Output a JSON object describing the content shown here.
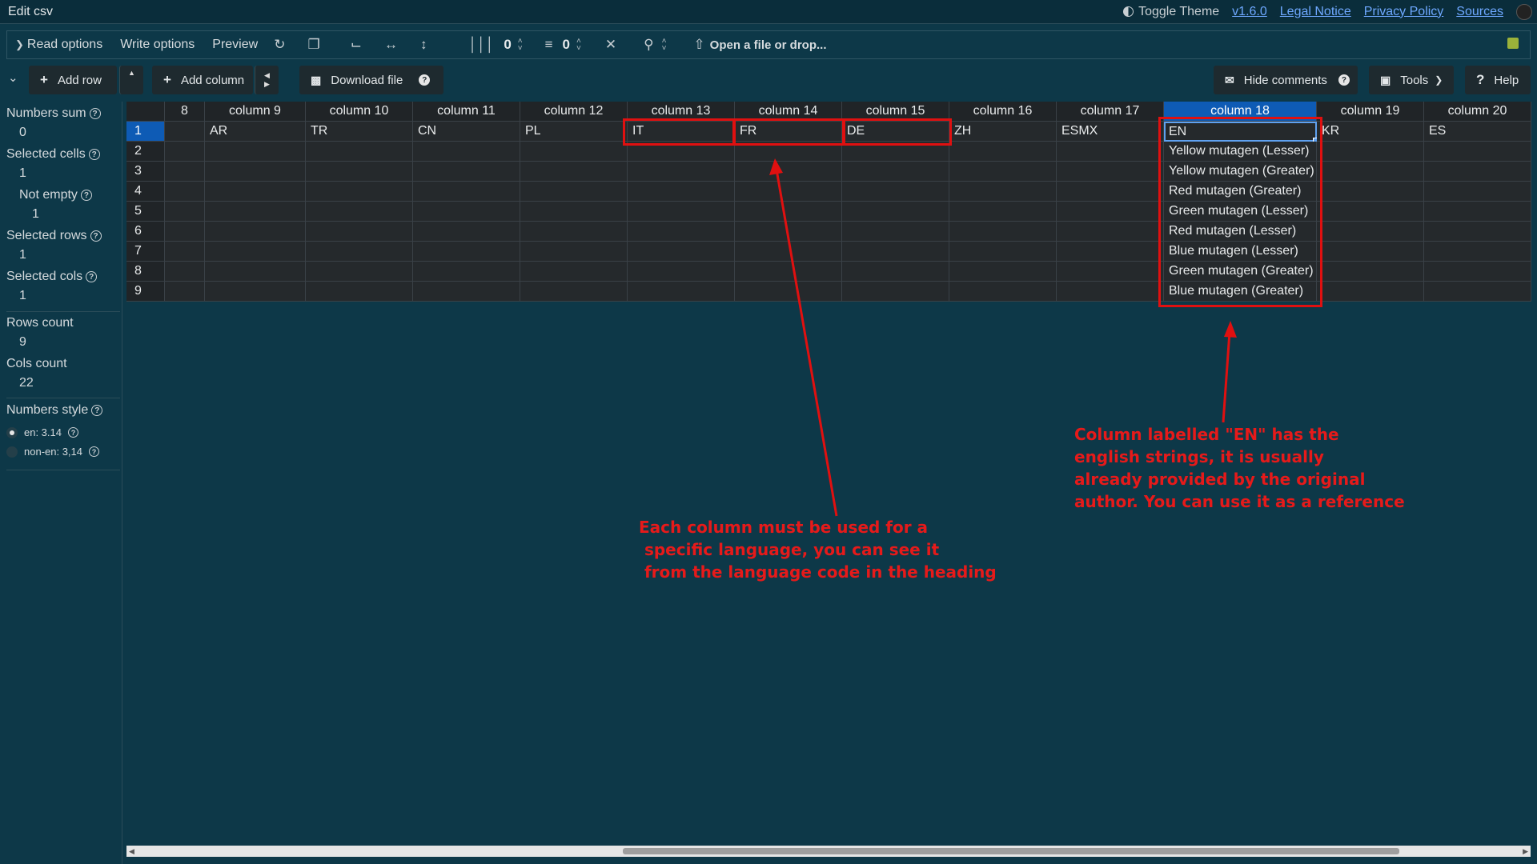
{
  "window": {
    "title": "Edit csv",
    "theme_toggle": "Toggle Theme",
    "links": [
      "v1.6.0",
      "Legal Notice",
      "Privacy Policy",
      "Sources"
    ]
  },
  "toolbar": {
    "read_options": "Read options",
    "write_options": "Write options",
    "preview": "Preview",
    "fixed_cols_value": "0",
    "fixed_rows_value": "0",
    "open_file": "Open a file or drop...",
    "icons": [
      "reload-icon",
      "copy-icon",
      "resize-icon",
      "expand-horizontal-icon",
      "expand-vertical-icon",
      "fixed-columns-icon",
      "fixed-rows-icon",
      "close-wrap-icon",
      "zoom-icon",
      "upload-icon",
      "save-icon"
    ]
  },
  "actions": {
    "add_row": "Add row",
    "add_column": "Add column",
    "download_file": "Download file",
    "hide_comments": "Hide comments",
    "tools": "Tools",
    "help": "Help"
  },
  "stats": {
    "numbers_sum_label": "Numbers sum",
    "numbers_sum": "0",
    "selected_cells_label": "Selected cells",
    "selected_cells": "1",
    "not_empty_label": "Not empty",
    "not_empty": "1",
    "selected_rows_label": "Selected rows",
    "selected_rows": "1",
    "selected_cols_label": "Selected cols",
    "selected_cols": "1",
    "rows_count_label": "Rows count",
    "rows_count": "9",
    "cols_count_label": "Cols count",
    "cols_count": "22",
    "numbers_style_label": "Numbers style",
    "style_en": "en: 3.14",
    "style_non_en": "non-en: 3,14"
  },
  "table": {
    "headers": [
      "8",
      "column 9",
      "column 10",
      "column 11",
      "column 12",
      "column 13",
      "column 14",
      "column 15",
      "column 16",
      "column 17",
      "column 18",
      "column 19",
      "column 20"
    ],
    "selected_header": "column 18",
    "row_numbers": [
      "1",
      "2",
      "3",
      "4",
      "5",
      "6",
      "7",
      "8",
      "9"
    ],
    "row1": [
      "",
      "AR",
      "TR",
      "CN",
      "PL",
      "IT",
      "FR",
      "DE",
      "ZH",
      "ESMX",
      "EN",
      "KR",
      "ES"
    ],
    "en_column": [
      "EN",
      "Yellow mutagen (Lesser)",
      "Yellow mutagen (Greater)",
      "Red mutagen (Greater)",
      "Green mutagen (Lesser)",
      "Red mutagen (Lesser)",
      "Blue mutagen (Lesser)",
      "Green mutagen (Greater)",
      "Blue mutagen (Greater)"
    ]
  },
  "annotations": {
    "note_columns": "Each column must be used for a\n specific language, you can see it\n from the language code in the heading",
    "note_en": "Column labelled \"EN\" has the\nenglish strings, it is usually\nalready provided by the original\nauthor. You can use it as a reference",
    "color": "#e01010"
  }
}
